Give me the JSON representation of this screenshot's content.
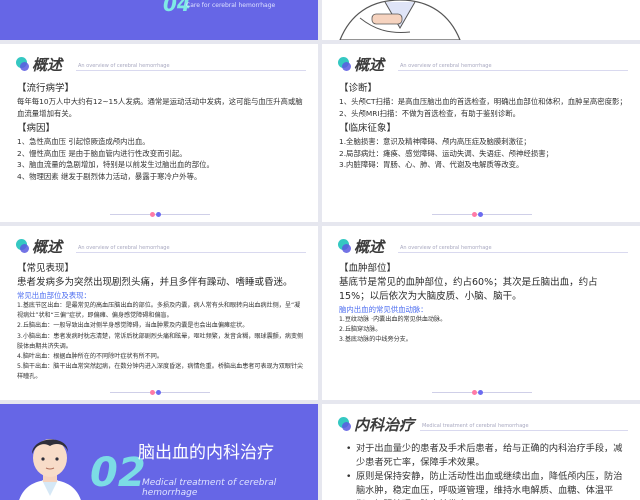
{
  "top_left": {
    "num": "04",
    "subtitle": "Care for cerebral hemorrhage"
  },
  "slide_diagnosis_left": {
    "title": "概述",
    "subtitle": "An overview of cerebral hemorrhage",
    "epi_heading": "【流行病学】",
    "epi_text": "每年每10万人中大约有12~15人发病。通常是运动活动中发病，这可能与血压升高或脑血流量增加有关。",
    "cause_heading": "【病因】",
    "causes": [
      "1、急性高血压 引起惊厥造成颅内出血。",
      "2、慢性高血压 是由于脑血管内进行性改变而引起。",
      "3、脑血流量的急剧增加，特别是以前发生过脑出血的部位。",
      "4、物理因素 继发于剧烈体力活动，暴露于寒冷户外等。"
    ]
  },
  "slide_diagnosis_right": {
    "title": "概述",
    "subtitle": "An overview of cerebral hemorrhage",
    "diag_heading": "【诊断】",
    "diag_items": [
      "1、头颅CT扫描：是高血压脑出血的首选检查，明确出血部位和体积，血肿呈高密度影；",
      "2、头颅MRI扫描：不做为首选检查，有助于鉴别诊断。"
    ],
    "clin_heading": "【临床征象】",
    "clin_items": [
      "1.全脑损害：意识及精神障碍、颅内高压症及脑膜刺激征；",
      "2.局部病灶：瘫痪、感觉障碍、运动失调、失语症、颅神经损害；",
      "3.内脏障碍：胃肠、心、肺、肾、代谢及电解质等改变。"
    ]
  },
  "slide_symptoms_left": {
    "title": "概述",
    "subtitle": "An overview of cerebral hemorrhage",
    "heading": "【常见表现】",
    "intro": "患者发病多为突然出现剧烈头痛，并且多伴有躁动、嗜睡或昏迷。",
    "blue_heading": "常见出血部位及表现：",
    "items": [
      "1.基底节区出血：是最常见的高血压脑出血的部位。多损及内囊，病人常有头和眼转向出血病灶侧，呈“凝视病灶”状和“三偏”症状，即偏瘫、偏身感觉障碍和偏盲。",
      "2.丘脑出血：一般导致出血对侧半身感觉障碍，当血肿累及内囊是也会出血偏瘫症状。",
      "3.小脑出血：患者发病时枕志清楚，常诉后枕部剧烈头痛和眩晕，呕吐频繁，发音含糊，眼球震颤，病变侧肢体由期共济失调。",
      "4.脑叶出血：根据血肿所在的不同除叶症状有所不同。",
      "5.脑干出血：脑干出血常突然起病，在数分钟内进入深度昏迷，病情危重。桥脑出血患者可表现为双眼针尖样瞳孔。"
    ]
  },
  "slide_symptoms_right": {
    "title": "概述",
    "subtitle": "An overview of cerebral hemorrhage",
    "heading": "【血肿部位】",
    "intro": "基底节是常见的血肿部位，约占60%；其次是丘脑出血，约占15%；以后依次为大脑皮质、小脑、脑干。",
    "blue_heading": "脑内出血的常见供血动脉：",
    "items": [
      "1.豆纹动脉 ·内囊出血的常见供血动脉。",
      "2.丘脑穿动脉。",
      "3.基底动脉的中线旁分支。"
    ]
  },
  "section_slide": {
    "num": "02",
    "title": "脑出血的内科治疗",
    "subtitle": "Medical treatment of cerebral hemorrhage"
  },
  "slide_treatment": {
    "title": "内科治疗",
    "subtitle": "Medical treatment of cerebral hemorrhage",
    "items": [
      "对于出血量少的患者及手术后患者，给与正确的内科治疗手段，减少患者死亡率，保障手术效果。",
      "原则是保持安静，防止活动性出血或继续出血，降低颅内压，防治脑水肿，稳定血压，呼吸道管理，维持水电解质、血糖、体温平衡，加强护理，防止并发症。"
    ]
  },
  "colors": {
    "accent_blue": "#6666e6",
    "teal": "#35c8c2",
    "link_blue": "#4b6cf0"
  }
}
